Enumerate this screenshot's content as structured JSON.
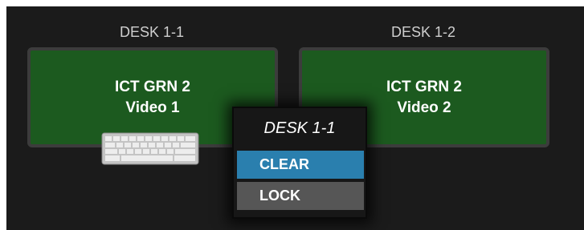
{
  "desks": [
    {
      "label": "DESK 1-1",
      "line1": "ICT GRN 2",
      "line2": "Video 1"
    },
    {
      "label": "DESK 1-2",
      "line1": "ICT GRN 2",
      "line2": "Video 2"
    }
  ],
  "context_menu": {
    "title": "DESK 1-1",
    "items": [
      {
        "label": "CLEAR",
        "highlighted": true
      },
      {
        "label": "LOCK",
        "highlighted": false
      }
    ]
  },
  "colors": {
    "background": "#1b1b1b",
    "tile_green": "#1c5a1f",
    "highlight_blue": "#2a7fae",
    "item_gray": "#565656"
  },
  "icons": {
    "keyboard": "keyboard-icon"
  }
}
